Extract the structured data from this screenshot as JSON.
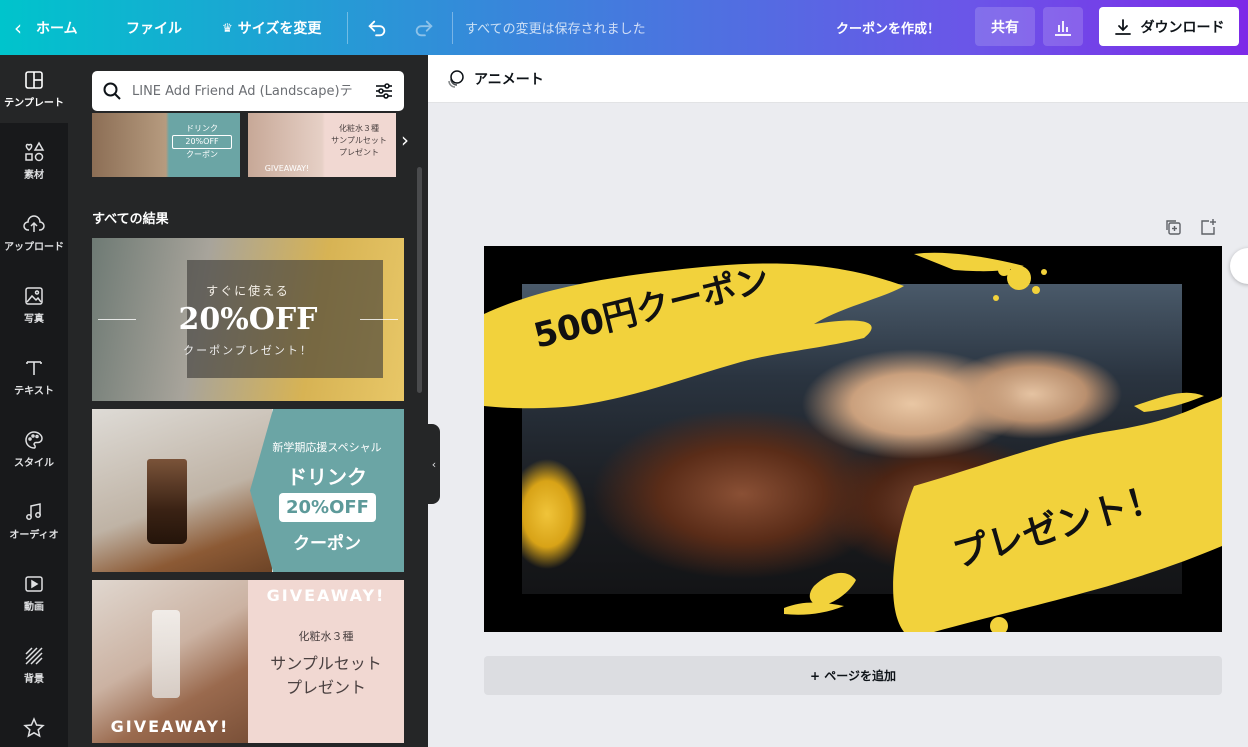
{
  "topbar": {
    "home_label": "ホーム",
    "file_label": "ファイル",
    "resize_label": "サイズを変更",
    "save_status": "すべての変更は保存されました",
    "coupon_label": "クーポンを作成！",
    "share_label": "共有",
    "download_label": "ダウンロード"
  },
  "nav": {
    "items": [
      {
        "label": "テンプレート",
        "icon": "template-icon"
      },
      {
        "label": "素材",
        "icon": "elements-icon"
      },
      {
        "label": "アップロード",
        "icon": "upload-icon"
      },
      {
        "label": "写真",
        "icon": "photo-icon"
      },
      {
        "label": "テキスト",
        "icon": "text-icon"
      },
      {
        "label": "スタイル",
        "icon": "palette-icon"
      },
      {
        "label": "オーディオ",
        "icon": "music-icon"
      },
      {
        "label": "動画",
        "icon": "video-icon"
      },
      {
        "label": "背景",
        "icon": "background-icon"
      }
    ]
  },
  "panel": {
    "search_placeholder": "LINE Add Friend Ad (Landscape)テ",
    "results_title": "すべての結果",
    "strip": [
      {
        "lines": [
          "ドリンク",
          "20%OFF",
          "クーポン"
        ]
      },
      {
        "lines": [
          "化粧水３種",
          "サンプルセット",
          "プレゼント"
        ],
        "tag": "GIVEAWAY!"
      }
    ],
    "cards": [
      {
        "line1": "すぐに使える",
        "line2": "20%OFF",
        "line3": "クーポンプレゼント！"
      },
      {
        "line1": "新学期応援スペシャル",
        "line2": "ドリンク",
        "line3": "20%OFF",
        "line4": "クーポン"
      },
      {
        "tag_top": "GIVEAWAY!",
        "line1": "化粧水３種",
        "line2": "サンプルセット",
        "line3": "プレゼント",
        "tag_bottom": "GIVEAWAY!"
      }
    ]
  },
  "editor": {
    "animate_label": "アニメート",
    "add_page_label": "+ ページを追加"
  },
  "design": {
    "title": "500円クーポン",
    "subtitle": "プレゼント！",
    "accent_color": "#f2d23c",
    "background_color": "#000000"
  }
}
